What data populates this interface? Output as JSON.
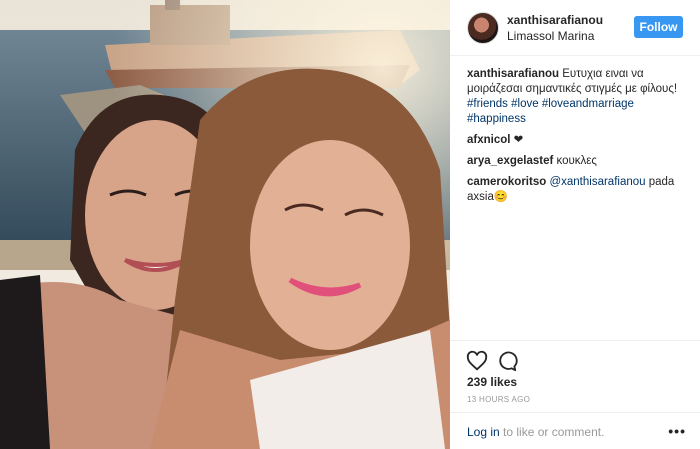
{
  "post": {
    "username": "xanthisarafianou",
    "location": "Limassol Marina",
    "follow_label": "Follow",
    "photo_alt": "Two women taking a selfie in front of a shipwreck"
  },
  "comments": [
    {
      "user": "xanthisarafianou",
      "text": "Ευτυχια ειναι να μοιράζεσαι σημαντικές στιγμές με φίλους!",
      "tags": [
        "#friends",
        "#love",
        "#loveandmarriage",
        "#happiness"
      ]
    },
    {
      "user": "afxnicol",
      "text": "❤"
    },
    {
      "user": "arya_exgelastef",
      "text": "κουκλες"
    },
    {
      "user": "camerokoritso",
      "mention": "@xanthisarafianou",
      "text": "pada axsia😊"
    }
  ],
  "actions": {
    "likes": "239 likes",
    "time": "13 HOURS AGO"
  },
  "footer": {
    "login_link": "Log in",
    "login_rest": " to like or comment.",
    "more": "•••"
  }
}
